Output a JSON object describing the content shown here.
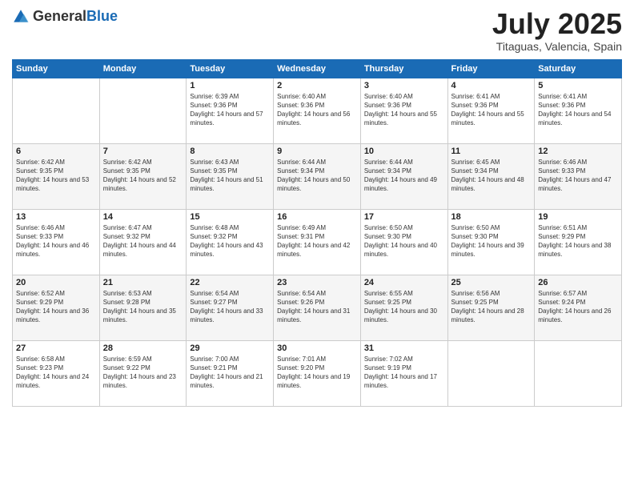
{
  "logo": {
    "general": "General",
    "blue": "Blue"
  },
  "header": {
    "month": "July 2025",
    "location": "Titaguas, Valencia, Spain"
  },
  "weekdays": [
    "Sunday",
    "Monday",
    "Tuesday",
    "Wednesday",
    "Thursday",
    "Friday",
    "Saturday"
  ],
  "weeks": [
    [
      {
        "day": "",
        "info": ""
      },
      {
        "day": "",
        "info": ""
      },
      {
        "day": "1",
        "info": "Sunrise: 6:39 AM\nSunset: 9:36 PM\nDaylight: 14 hours and 57 minutes."
      },
      {
        "day": "2",
        "info": "Sunrise: 6:40 AM\nSunset: 9:36 PM\nDaylight: 14 hours and 56 minutes."
      },
      {
        "day": "3",
        "info": "Sunrise: 6:40 AM\nSunset: 9:36 PM\nDaylight: 14 hours and 55 minutes."
      },
      {
        "day": "4",
        "info": "Sunrise: 6:41 AM\nSunset: 9:36 PM\nDaylight: 14 hours and 55 minutes."
      },
      {
        "day": "5",
        "info": "Sunrise: 6:41 AM\nSunset: 9:36 PM\nDaylight: 14 hours and 54 minutes."
      }
    ],
    [
      {
        "day": "6",
        "info": "Sunrise: 6:42 AM\nSunset: 9:35 PM\nDaylight: 14 hours and 53 minutes."
      },
      {
        "day": "7",
        "info": "Sunrise: 6:42 AM\nSunset: 9:35 PM\nDaylight: 14 hours and 52 minutes."
      },
      {
        "day": "8",
        "info": "Sunrise: 6:43 AM\nSunset: 9:35 PM\nDaylight: 14 hours and 51 minutes."
      },
      {
        "day": "9",
        "info": "Sunrise: 6:44 AM\nSunset: 9:34 PM\nDaylight: 14 hours and 50 minutes."
      },
      {
        "day": "10",
        "info": "Sunrise: 6:44 AM\nSunset: 9:34 PM\nDaylight: 14 hours and 49 minutes."
      },
      {
        "day": "11",
        "info": "Sunrise: 6:45 AM\nSunset: 9:34 PM\nDaylight: 14 hours and 48 minutes."
      },
      {
        "day": "12",
        "info": "Sunrise: 6:46 AM\nSunset: 9:33 PM\nDaylight: 14 hours and 47 minutes."
      }
    ],
    [
      {
        "day": "13",
        "info": "Sunrise: 6:46 AM\nSunset: 9:33 PM\nDaylight: 14 hours and 46 minutes."
      },
      {
        "day": "14",
        "info": "Sunrise: 6:47 AM\nSunset: 9:32 PM\nDaylight: 14 hours and 44 minutes."
      },
      {
        "day": "15",
        "info": "Sunrise: 6:48 AM\nSunset: 9:32 PM\nDaylight: 14 hours and 43 minutes."
      },
      {
        "day": "16",
        "info": "Sunrise: 6:49 AM\nSunset: 9:31 PM\nDaylight: 14 hours and 42 minutes."
      },
      {
        "day": "17",
        "info": "Sunrise: 6:50 AM\nSunset: 9:30 PM\nDaylight: 14 hours and 40 minutes."
      },
      {
        "day": "18",
        "info": "Sunrise: 6:50 AM\nSunset: 9:30 PM\nDaylight: 14 hours and 39 minutes."
      },
      {
        "day": "19",
        "info": "Sunrise: 6:51 AM\nSunset: 9:29 PM\nDaylight: 14 hours and 38 minutes."
      }
    ],
    [
      {
        "day": "20",
        "info": "Sunrise: 6:52 AM\nSunset: 9:29 PM\nDaylight: 14 hours and 36 minutes."
      },
      {
        "day": "21",
        "info": "Sunrise: 6:53 AM\nSunset: 9:28 PM\nDaylight: 14 hours and 35 minutes."
      },
      {
        "day": "22",
        "info": "Sunrise: 6:54 AM\nSunset: 9:27 PM\nDaylight: 14 hours and 33 minutes."
      },
      {
        "day": "23",
        "info": "Sunrise: 6:54 AM\nSunset: 9:26 PM\nDaylight: 14 hours and 31 minutes."
      },
      {
        "day": "24",
        "info": "Sunrise: 6:55 AM\nSunset: 9:25 PM\nDaylight: 14 hours and 30 minutes."
      },
      {
        "day": "25",
        "info": "Sunrise: 6:56 AM\nSunset: 9:25 PM\nDaylight: 14 hours and 28 minutes."
      },
      {
        "day": "26",
        "info": "Sunrise: 6:57 AM\nSunset: 9:24 PM\nDaylight: 14 hours and 26 minutes."
      }
    ],
    [
      {
        "day": "27",
        "info": "Sunrise: 6:58 AM\nSunset: 9:23 PM\nDaylight: 14 hours and 24 minutes."
      },
      {
        "day": "28",
        "info": "Sunrise: 6:59 AM\nSunset: 9:22 PM\nDaylight: 14 hours and 23 minutes."
      },
      {
        "day": "29",
        "info": "Sunrise: 7:00 AM\nSunset: 9:21 PM\nDaylight: 14 hours and 21 minutes."
      },
      {
        "day": "30",
        "info": "Sunrise: 7:01 AM\nSunset: 9:20 PM\nDaylight: 14 hours and 19 minutes."
      },
      {
        "day": "31",
        "info": "Sunrise: 7:02 AM\nSunset: 9:19 PM\nDaylight: 14 hours and 17 minutes."
      },
      {
        "day": "",
        "info": ""
      },
      {
        "day": "",
        "info": ""
      }
    ]
  ]
}
